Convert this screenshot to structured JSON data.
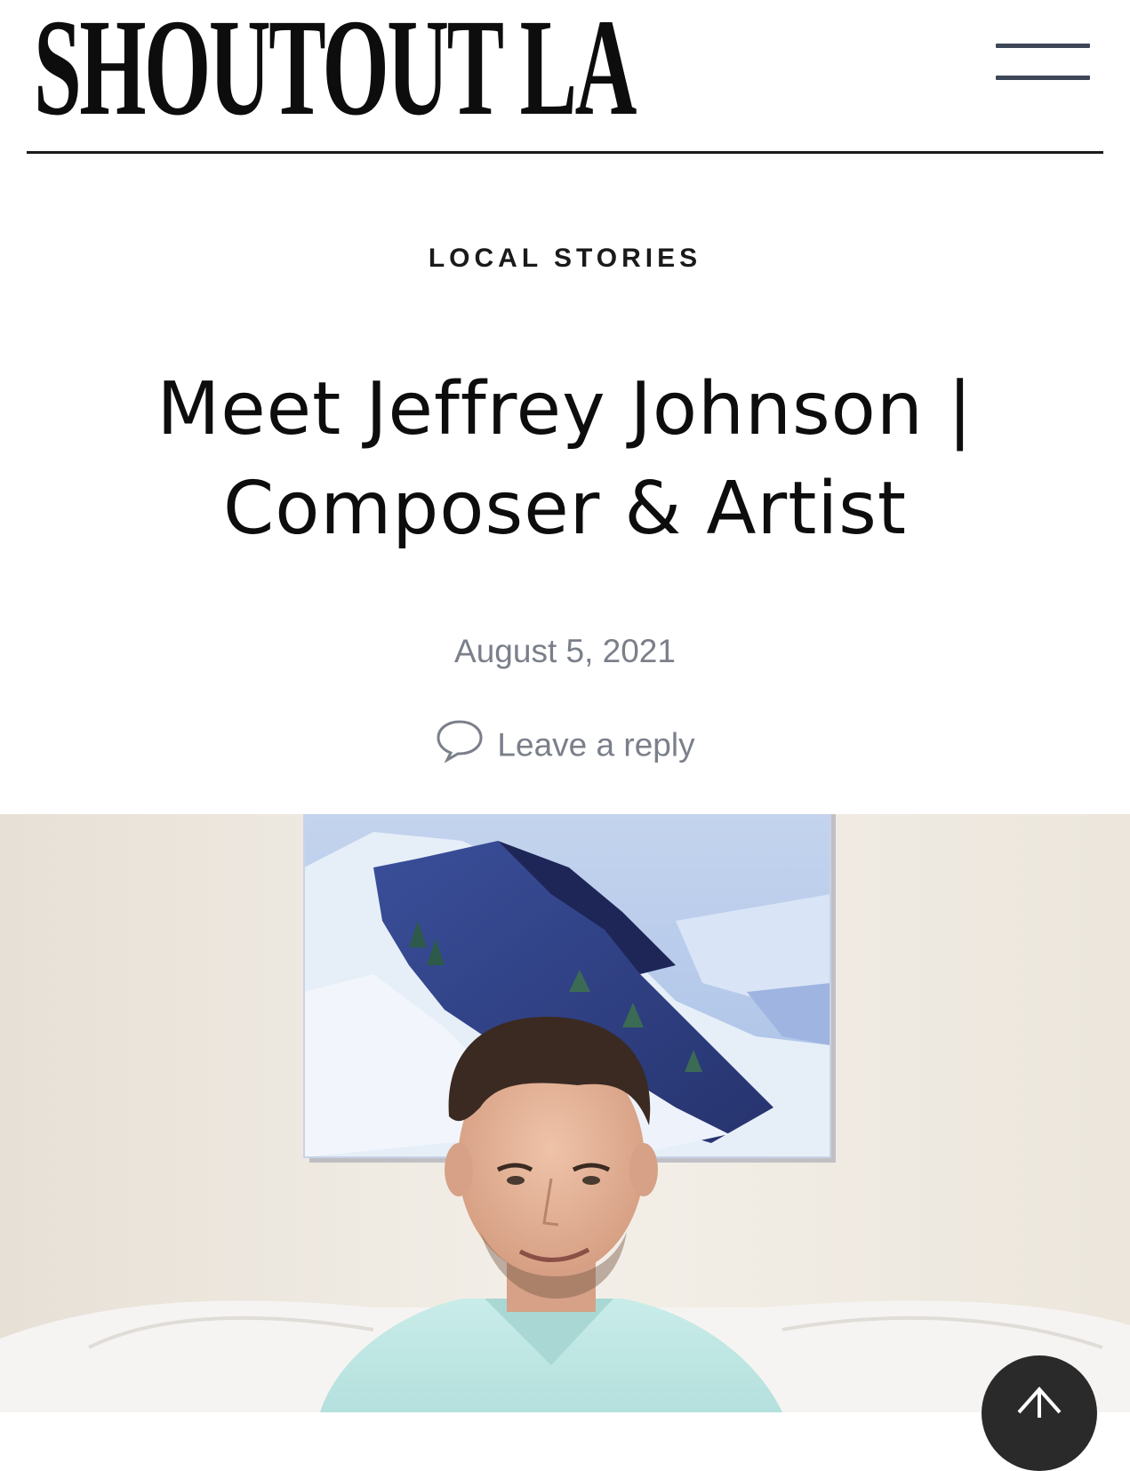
{
  "header": {
    "logo_text": "SHOUTOUT LA",
    "menu_icon": "hamburger-menu-icon"
  },
  "article": {
    "category": "LOCAL STORIES",
    "title_line1": "Meet Jeffrey Johnson |",
    "title_line2": "Composer & Artist",
    "date": "August 5, 2021",
    "reply_label": "Leave a reply",
    "reply_icon": "speech-bubble-icon"
  },
  "hero_image": {
    "subject": "portrait-photo",
    "scroll_top_icon": "arrow-up-icon"
  },
  "colors": {
    "menu_bar": "#3d4758",
    "meta_text": "#7a7f8a",
    "scroll_button": "#2a2a2a"
  }
}
